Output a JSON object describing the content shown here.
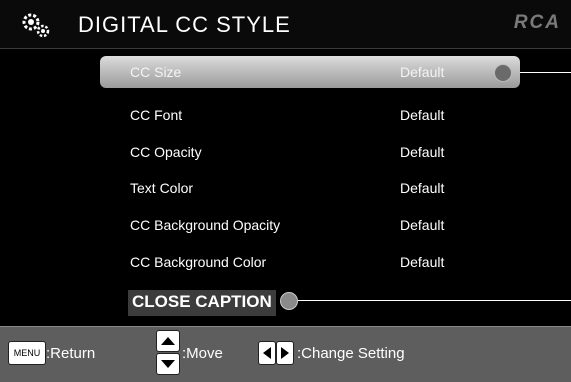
{
  "header": {
    "title": "DIGITAL CC STYLE",
    "logo": "RCA",
    "icon": "gear-icon"
  },
  "menu": {
    "items": [
      {
        "label": "CC Size",
        "value": "Default",
        "selected": true
      },
      {
        "label": "CC Font",
        "value": "Default"
      },
      {
        "label": "CC Opacity",
        "value": "Default"
      },
      {
        "label": "Text Color",
        "value": "Default"
      },
      {
        "label": "CC Background Opacity",
        "value": "Default"
      },
      {
        "label": "CC Background Color",
        "value": "Default"
      }
    ]
  },
  "breadcrumb": {
    "label": "CLOSE CAPTION"
  },
  "footer": {
    "menu_key": "MENU",
    "return_label": ":Return",
    "move_label": ":Move",
    "change_label": ":Change Setting"
  },
  "colors": {
    "background": "#000000",
    "footer": "#5e5e5e",
    "text": "#ffffff"
  }
}
